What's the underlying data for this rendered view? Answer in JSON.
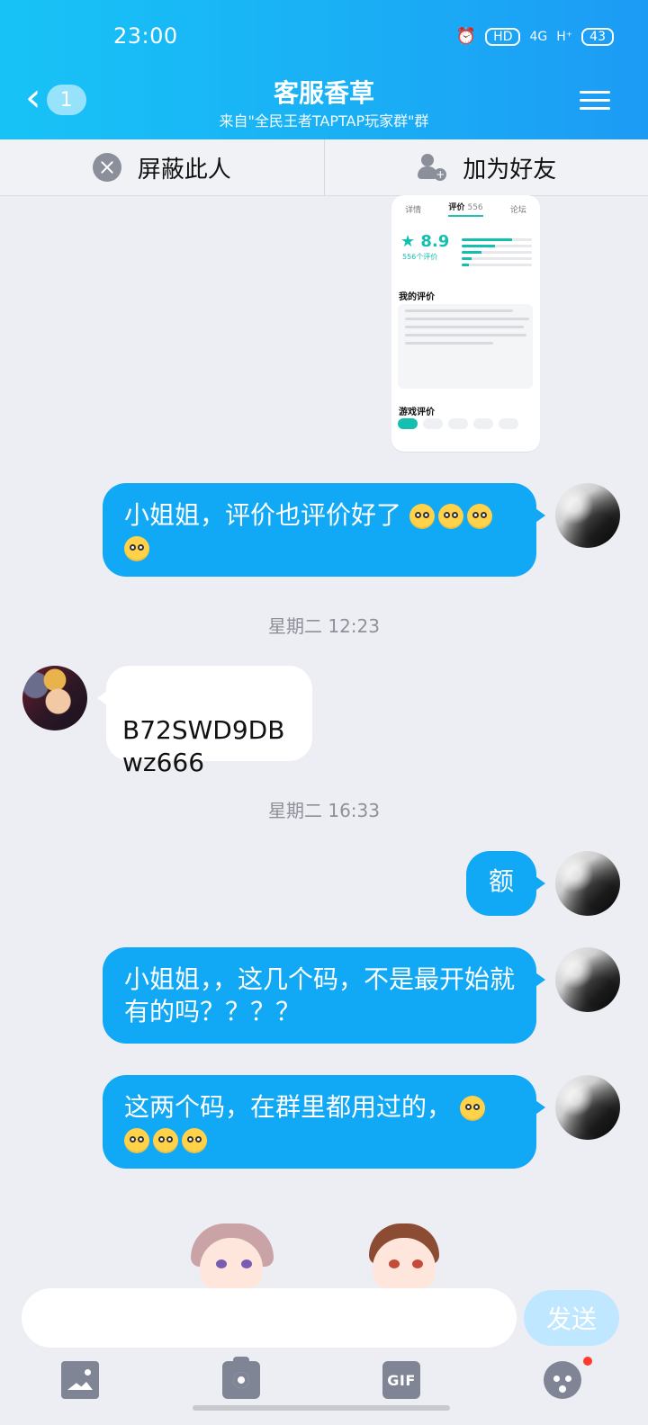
{
  "status_bar": {
    "time": "23:00",
    "icons": [
      "alarm-icon",
      "hd-icon",
      "4g-signal-icon",
      "h-plus-signal-icon",
      "battery-icon"
    ],
    "hd_label": "HD",
    "network_4g": "4G",
    "network_h": "H⁺",
    "battery": "43"
  },
  "header": {
    "back_badge": "1",
    "title": "客服香草",
    "subtitle": "来自\"全民王者TAPTAP玩家群\"群"
  },
  "actions": {
    "block_label": "屏蔽此人",
    "add_friend_label": "加为好友"
  },
  "messages": [
    {
      "side": "right",
      "text": "小姐姐，评价也评价好了"
    },
    {
      "time": "星期二 12:23"
    },
    {
      "side": "left",
      "text": "B72SWD9DB\nwz666"
    },
    {
      "time": "星期二 16:33"
    },
    {
      "side": "right",
      "text": "额"
    },
    {
      "side": "right",
      "text": "小姐姐，，这几个码，不是最开始就有的吗？？？？"
    },
    {
      "side": "right",
      "text": "这两个码，在群里都用过的，"
    }
  ],
  "screenshot_message": {
    "tabs": [
      "详情",
      "评价",
      "论坛"
    ],
    "reviews_count": "556",
    "score": "8.9",
    "score_sub": "556个评价",
    "section_my_review": "我的评价",
    "section_game_reviews": "游戏评价"
  },
  "input": {
    "placeholder": "",
    "send_label": "发送"
  },
  "toolbar": {
    "gif_label": "GIF"
  }
}
